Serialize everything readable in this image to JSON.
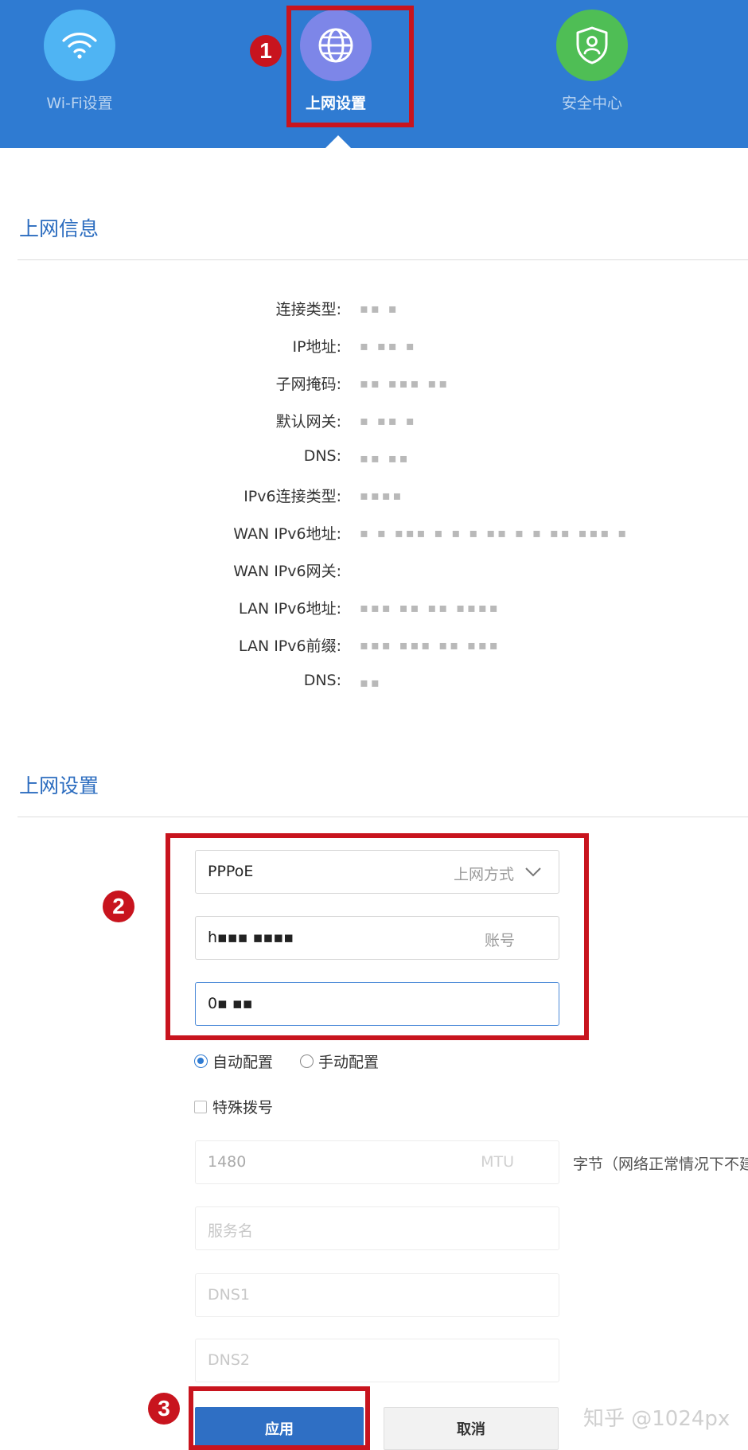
{
  "nav": {
    "items": [
      {
        "label": "Wi-Fi设置",
        "icon": "wifi-icon"
      },
      {
        "label": "上网设置",
        "icon": "globe-icon",
        "active": true
      },
      {
        "label": "安全中心",
        "icon": "shield-user-icon"
      }
    ]
  },
  "annotations": {
    "step1": "1",
    "step2": "2",
    "step3": "3"
  },
  "info": {
    "title": "上网信息",
    "rows": [
      {
        "label": "连接类型:",
        "value": "▪▪ ▪"
      },
      {
        "label": "IP地址:",
        "value": "▪ ▪▪ ▪"
      },
      {
        "label": "子网掩码:",
        "value": "▪▪ ▪▪▪ ▪▪"
      },
      {
        "label": "默认网关:",
        "value": "▪ ▪▪ ▪"
      },
      {
        "label": "DNS:",
        "value": "▪▪ ▪▪"
      },
      {
        "label": "IPv6连接类型:",
        "value": "▪▪▪▪"
      },
      {
        "label": "WAN IPv6地址:",
        "value": "▪ ▪ ▪▪▪ ▪ ▪ ▪ ▪▪ ▪ ▪ ▪▪ ▪▪▪ ▪"
      },
      {
        "label": "WAN IPv6网关:",
        "value": ""
      },
      {
        "label": "LAN IPv6地址:",
        "value": "▪▪▪ ▪▪ ▪▪ ▪▪▪▪"
      },
      {
        "label": "LAN IPv6前缀:",
        "value": "▪▪▪ ▪▪▪ ▪▪ ▪▪▪"
      },
      {
        "label": "DNS:",
        "value": "▪▪"
      }
    ]
  },
  "settings": {
    "title": "上网设置",
    "mode_value": "PPPoE",
    "mode_tag": "上网方式",
    "account_value": "h▪▪▪ ▪▪▪▪",
    "account_tag": "账号",
    "password_value": "0▪  ▪▪",
    "radio_auto": "自动配置",
    "radio_manual": "手动配置",
    "special_dial": "特殊拨号",
    "mtu_value": "1480",
    "mtu_tag": "MTU",
    "mtu_hint": "字节（网络正常情况下不建",
    "service_placeholder": "服务名",
    "dns1_placeholder": "DNS1",
    "dns2_placeholder": "DNS2",
    "apply_label": "应用",
    "cancel_label": "取消"
  },
  "watermark": "知乎 @1024px"
}
